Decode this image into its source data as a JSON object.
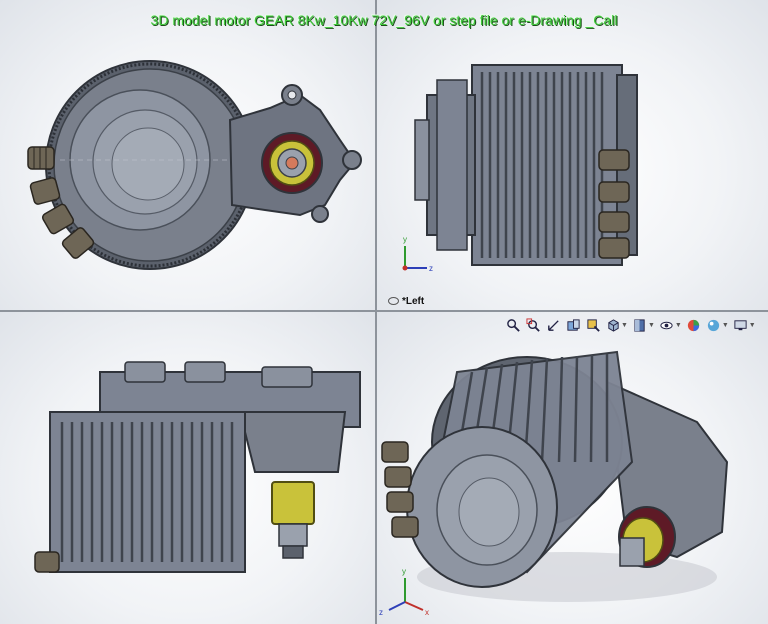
{
  "title": "3D model motor GEAR 8Kw_10Kw 72V_96V or step file or e-Drawing _Call",
  "viewports": {
    "top_left": {
      "name": "front"
    },
    "top_right": {
      "name": "left",
      "label": "*Left"
    },
    "bottom_left": {
      "name": "top"
    },
    "bottom_right": {
      "name": "isometric"
    }
  },
  "triad": {
    "x": "x",
    "y": "y",
    "z": "z"
  },
  "toolbar": {
    "icons": [
      "zoom-to-fit-icon",
      "zoom-area-icon",
      "previous-view-icon",
      "section-view-icon",
      "dynamic-annotation-icon",
      "view-orientation-icon",
      "display-style-icon",
      "hide-show-items-icon",
      "edit-appearance-icon",
      "apply-scene-icon",
      "view-settings-icon"
    ]
  },
  "colors": {
    "title_green": "#3fc83a",
    "motor_gray": "#7d8493",
    "dark_gray": "#3f444d",
    "gold": "#c9c23a",
    "maroon": "#6b1b2a",
    "divider": "#8d939b"
  }
}
